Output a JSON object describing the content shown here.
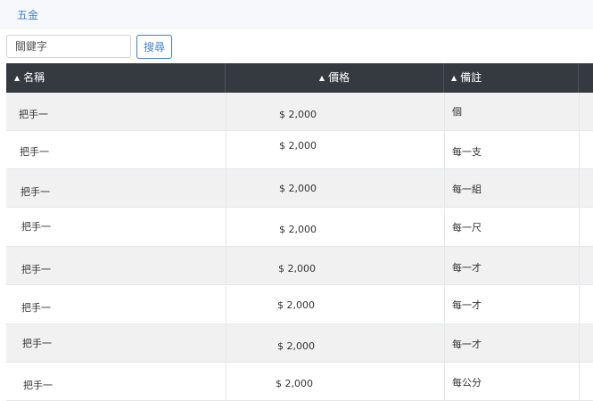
{
  "breadcrumb": {
    "label": "五金"
  },
  "search": {
    "placeholder": "關鍵字",
    "button_label": "搜尋"
  },
  "table": {
    "columns": [
      {
        "label": "名稱",
        "sort_icon": "sort-up-icon"
      },
      {
        "label": "價格",
        "sort_icon": "sort-icon"
      },
      {
        "label": "備註",
        "sort_icon": "sort-icon"
      }
    ],
    "rows": [
      {
        "name": "把手一",
        "price": "$ 2,000",
        "remark": "個"
      },
      {
        "name": "把手一",
        "price": "$ 2,000",
        "remark": "每一支"
      },
      {
        "name": "把手一",
        "price": "$ 2,000",
        "remark": "每一組"
      },
      {
        "name": "把手一",
        "price": "$ 2,000",
        "remark": "每一尺"
      },
      {
        "name": "把手一",
        "price": "$ 2,000",
        "remark": "每一才"
      },
      {
        "name": "把手一",
        "price": "$ 2,000",
        "remark": "每一才"
      },
      {
        "name": "把手一",
        "price": "$ 2,000",
        "remark": "每一才"
      },
      {
        "name": "把手一",
        "price": "$ 2,000",
        "remark": "每公分"
      }
    ]
  },
  "colors": {
    "header_bg": "#343a40",
    "accent": "#3d7fd1",
    "stripe": "#f1f1f1"
  }
}
